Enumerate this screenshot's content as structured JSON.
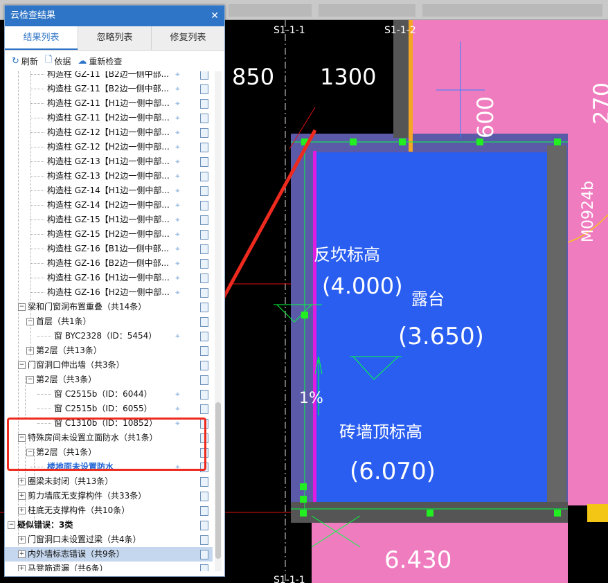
{
  "panel": {
    "title": "云检查结果",
    "close_glyph": "✕",
    "tabs": [
      "结果列表",
      "忽略列表",
      "修复列表"
    ],
    "actions": {
      "refresh": "刷新",
      "basis": "依据",
      "recheck": "重新检查"
    }
  },
  "tree_items": [
    "构造柱 GZ-11【B2边一侧中部...",
    "构造柱 GZ-11【B2边一侧中部...",
    "构造柱 GZ-11【H1边一侧中部...",
    "构造柱 GZ-11【H2边一侧中部...",
    "构造柱 GZ-12【H1边一侧中部...",
    "构造柱 GZ-12【H2边一侧中部...",
    "构造柱 GZ-13【H1边一侧中部...",
    "构造柱 GZ-13【H2边一侧中部...",
    "构造柱 GZ-14【H1边一侧中部...",
    "构造柱 GZ-14【H2边一侧中部...",
    "构造柱 GZ-15【H1边一侧中部...",
    "构造柱 GZ-15【H2边一侧中部...",
    "构造柱 GZ-16【B1边一侧中部...",
    "构造柱 GZ-16【B2边一侧中部...",
    "构造柱 GZ-16【H1边一侧中部...",
    "构造柱 GZ-16【H2边一侧中部...",
    "梁和门窗洞布置重叠（共14条）",
    "首层（共1条）",
    "窗 BYC2328（ID：5454）",
    "第2层（共13条）",
    "门窗洞口伸出墙（共3条）",
    "第2层（共3条）",
    "窗 C2515b（ID：6044）",
    "窗 C2515b（ID：6055）",
    "窗 C1310b（ID：10852）",
    "特殊房间未设置立面防水（共1条）",
    "第2层（共1条）",
    "楼地面未设置防水",
    "圈梁未封闭（共13条）",
    "剪力墙底无支撑构件（共33条）",
    "柱底无支撑构件（共10条）",
    "疑似错误：3类",
    "门窗洞口未设置过梁（共4条）",
    "内外墙标志错误（共9条）",
    "马凳筋遗漏（共6条）"
  ],
  "icons": {
    "refresh": "refresh-icon",
    "basis": "document-search-icon",
    "recheck": "cloud-icon",
    "locate": "locate-icon",
    "detail": "document-icon"
  },
  "cad": {
    "labels": [
      "S1-1-1",
      "S1-1-2",
      "850",
      "1300",
      "600",
      "270",
      "M0924b",
      "反坎标高",
      "(4.000)",
      "露台",
      "(3.650)",
      "1%",
      "砖墙顶标高",
      "(6.070)",
      "6.430",
      "S1-1-1"
    ]
  },
  "colors": {
    "accent": "#2f75c7",
    "highlight_box": "#ee2a1f",
    "selected_row": "#c5d7ee",
    "cad_pink": "#f07cc0",
    "cad_blue": "#2a5ef0"
  }
}
